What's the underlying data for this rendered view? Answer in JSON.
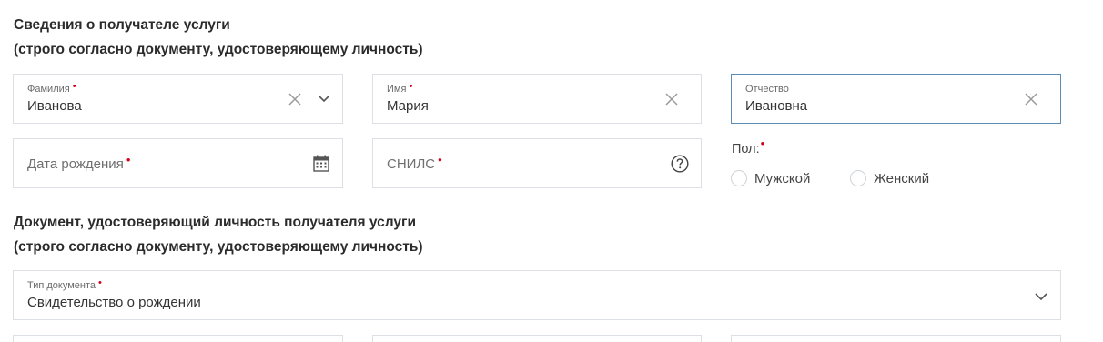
{
  "recipient_section": {
    "title": "Сведения о получателе услуги",
    "subtitle": "(строго согласно документу, удостоверяющему личность)"
  },
  "surname": {
    "label": "Фамилия",
    "value": "Иванова"
  },
  "name": {
    "label": "Имя",
    "value": "Мария"
  },
  "patronymic": {
    "label": "Отчество",
    "value": "Ивановна"
  },
  "birth_date": {
    "placeholder": "Дата рождения"
  },
  "snils": {
    "placeholder": "СНИЛС"
  },
  "gender": {
    "label": "Пол:",
    "options": [
      "Мужской",
      "Женский"
    ]
  },
  "document_section": {
    "title": "Документ, удостоверяющий личность получателя услуги",
    "subtitle": "(строго согласно документу, удостоверяющему личность)"
  },
  "document_type": {
    "label": "Тип документа",
    "value": "Свидетельство о рождении"
  },
  "colors": {
    "required": "#d0021b",
    "focus_border": "#5b8db6",
    "border": "#dcdfe3"
  }
}
